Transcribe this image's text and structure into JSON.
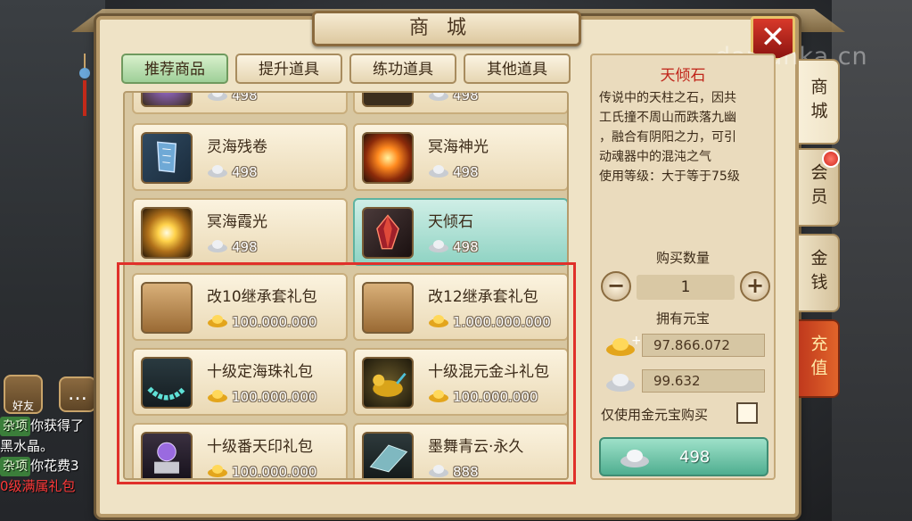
{
  "shop": {
    "title": "商城",
    "watermark": "dawanka.cn",
    "tabs": [
      "推荐商品",
      "提升道具",
      "练功道具",
      "其他道具"
    ],
    "active_tab": 0
  },
  "items": [
    {
      "name": "",
      "price": "498",
      "currency": "silver"
    },
    {
      "name": "",
      "price": "498",
      "currency": "silver"
    },
    {
      "name": "灵海残卷",
      "price": "498",
      "currency": "silver",
      "icon": "scroll-icon"
    },
    {
      "name": "冥海神光",
      "price": "498",
      "currency": "silver",
      "icon": "explosion-icon"
    },
    {
      "name": "冥海霞光",
      "price": "498",
      "currency": "silver",
      "icon": "light-burst-icon"
    },
    {
      "name": "天倾石",
      "price": "498",
      "currency": "silver",
      "icon": "crystal-icon",
      "selected": true
    },
    {
      "name": "改10继承套礼包",
      "price": "100.000.000",
      "currency": "gold",
      "icon": "parchment-icon"
    },
    {
      "name": "改12继承套礼包",
      "price": "1.000.000.000",
      "currency": "gold",
      "icon": "parchment-icon"
    },
    {
      "name": "十级定海珠礼包",
      "price": "100.000.000",
      "currency": "gold",
      "icon": "bead-necklace-icon"
    },
    {
      "name": "十级混元金斗礼包",
      "price": "100.000.000",
      "currency": "gold",
      "icon": "golden-beast-icon"
    },
    {
      "name": "十级番天印礼包",
      "price": "100.000.000",
      "currency": "gold",
      "icon": "seal-orb-icon"
    },
    {
      "name": "墨舞青云·永久",
      "price": "888",
      "currency": "silver",
      "icon": "flying-cloth-icon"
    }
  ],
  "detail": {
    "name": "天倾石",
    "desc": [
      "传说中的天柱之石，因共",
      "工氏撞不周山而跌落九幽",
      "，融合有阴阳之力，可引",
      "动魂器中的混沌之气",
      "使用等级：大于等于75级"
    ],
    "qty_label": "购买数量",
    "qty": "1",
    "owned_label": "拥有元宝",
    "gold_balance": "97.866.072",
    "silver_balance": "99.632",
    "gold_only_label": "仅使用金元宝购买",
    "buy_price": "498"
  },
  "side_tabs": [
    "商城",
    "会员",
    "金钱",
    "充值"
  ],
  "hud": {
    "friend_label": "好友",
    "chat": [
      {
        "tag": "杂项",
        "text": "你获得了"
      },
      {
        "tag": "",
        "text": "黑水晶。"
      },
      {
        "tag": "杂项",
        "text": "你花费3"
      },
      {
        "tag": "",
        "text": "0级满属礼包",
        "red": true
      }
    ]
  },
  "colors": {
    "accent_red": "#c0251a",
    "selected_green": "#8fd3c3",
    "highlight": "#e0302a"
  }
}
